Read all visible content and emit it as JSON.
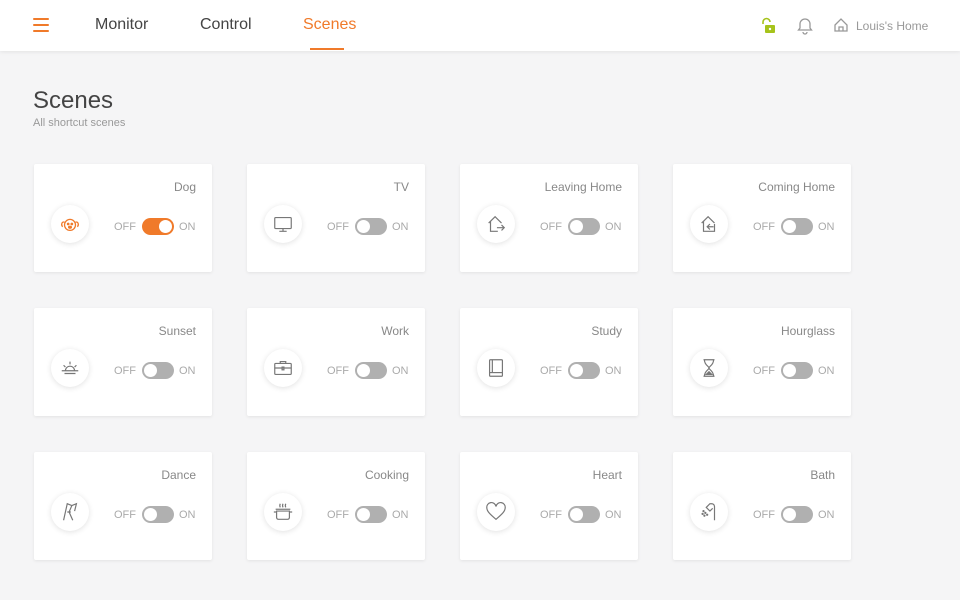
{
  "header": {
    "tabs": [
      {
        "label": "Monitor"
      },
      {
        "label": "Control"
      },
      {
        "label": "Scenes"
      }
    ],
    "active_tab": "Scenes",
    "home_label": "Louis's Home"
  },
  "page": {
    "title": "Scenes",
    "subtitle": "All shortcut scenes"
  },
  "toggle_labels": {
    "off": "OFF",
    "on": "ON"
  },
  "colors": {
    "accent": "#f07a2a",
    "lock": "#a6c31b"
  },
  "scenes": [
    {
      "name": "Dog",
      "icon": "dog-icon",
      "on": true
    },
    {
      "name": "TV",
      "icon": "tv-icon",
      "on": false
    },
    {
      "name": "Leaving Home",
      "icon": "leaving-home-icon",
      "on": false
    },
    {
      "name": "Coming Home",
      "icon": "coming-home-icon",
      "on": false
    },
    {
      "name": "Sunset",
      "icon": "sunset-icon",
      "on": false
    },
    {
      "name": "Work",
      "icon": "briefcase-icon",
      "on": false
    },
    {
      "name": "Study",
      "icon": "book-icon",
      "on": false
    },
    {
      "name": "Hourglass",
      "icon": "hourglass-icon",
      "on": false
    },
    {
      "name": "Dance",
      "icon": "dance-icon",
      "on": false
    },
    {
      "name": "Cooking",
      "icon": "pot-icon",
      "on": false
    },
    {
      "name": "Heart",
      "icon": "heart-icon",
      "on": false
    },
    {
      "name": "Bath",
      "icon": "shower-icon",
      "on": false
    }
  ]
}
